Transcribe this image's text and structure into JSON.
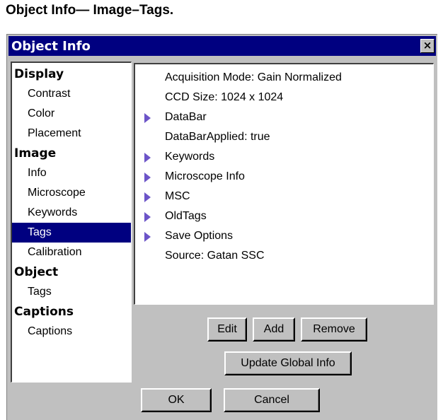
{
  "caption": "Object Info— Image–Tags.",
  "window": {
    "title": "Object Info",
    "close_label": "×"
  },
  "sidebar": {
    "sections": [
      {
        "heading": "Display",
        "items": [
          "Contrast",
          "Color",
          "Placement"
        ]
      },
      {
        "heading": "Image",
        "items": [
          "Info",
          "Microscope",
          "Keywords",
          "Tags",
          "Calibration"
        ]
      },
      {
        "heading": "Object",
        "items": [
          "Tags"
        ]
      },
      {
        "heading": "Captions",
        "items": [
          "Captions"
        ]
      }
    ],
    "selected": {
      "section": 1,
      "item": 3
    }
  },
  "tags": [
    {
      "label": "Acquisition Mode: Gain Normalized",
      "expandable": false
    },
    {
      "label": "CCD Size: 1024 x 1024",
      "expandable": false
    },
    {
      "label": "DataBar",
      "expandable": true
    },
    {
      "label": "DataBarApplied: true",
      "expandable": false
    },
    {
      "label": "Keywords",
      "expandable": true
    },
    {
      "label": "Microscope Info",
      "expandable": true
    },
    {
      "label": "MSC",
      "expandable": true
    },
    {
      "label": "OldTags",
      "expandable": true
    },
    {
      "label": "Save Options",
      "expandable": true
    },
    {
      "label": "Source: Gatan SSC",
      "expandable": false
    }
  ],
  "buttons": {
    "edit": "Edit",
    "add": "Add",
    "remove": "Remove",
    "update_global": "Update Global Info",
    "ok": "OK",
    "cancel": "Cancel"
  },
  "colors": {
    "titlebar": "#000080",
    "selection": "#000080",
    "expand_arrow": "#6c54c8",
    "dialog_face": "#c0c0c0"
  },
  "icons": {
    "expand": "triangle-right-icon",
    "close": "close-icon"
  }
}
